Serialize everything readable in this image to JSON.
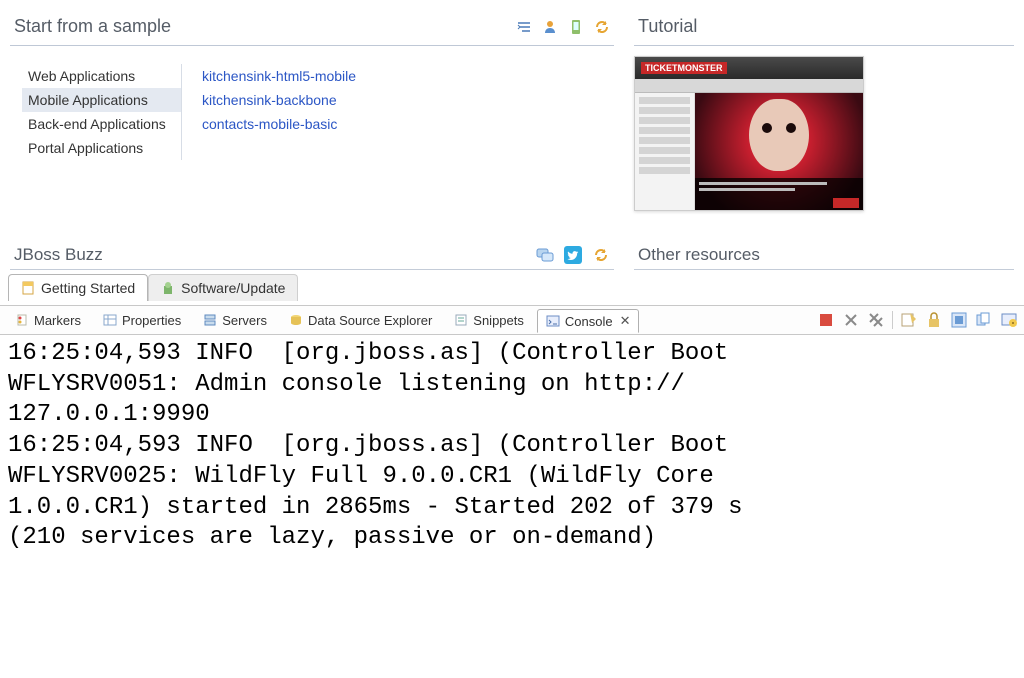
{
  "sample_section": {
    "title": "Start from a sample",
    "categories": [
      {
        "label": "Web Applications"
      },
      {
        "label": "Mobile Applications",
        "selected": true
      },
      {
        "label": "Back-end Applications"
      },
      {
        "label": "Portal Applications"
      }
    ],
    "projects": [
      {
        "label": "kitchensink-html5-mobile"
      },
      {
        "label": "kitchensink-backbone"
      },
      {
        "label": "contacts-mobile-basic"
      }
    ]
  },
  "tutorial_section": {
    "title": "Tutorial",
    "logo": "TICKETMONSTER"
  },
  "buzz_section": {
    "title": "JBoss Buzz"
  },
  "other_section": {
    "title": "Other resources"
  },
  "page_tabs": {
    "active": "Getting Started",
    "inactive": "Software/Update"
  },
  "views": {
    "markers": "Markers",
    "properties": "Properties",
    "servers": "Servers",
    "dse": "Data Source Explorer",
    "snippets": "Snippets",
    "console": "Console"
  },
  "console_output": "16:25:04,593 INFO  [org.jboss.as] (Controller Boot\nWFLYSRV0051: Admin console listening on http://\n127.0.0.1:9990\n16:25:04,593 INFO  [org.jboss.as] (Controller Boot\nWFLYSRV0025: WildFly Full 9.0.0.CR1 (WildFly Core \n1.0.0.CR1) started in 2865ms - Started 202 of 379 s\n(210 services are lazy, passive or on-demand)"
}
